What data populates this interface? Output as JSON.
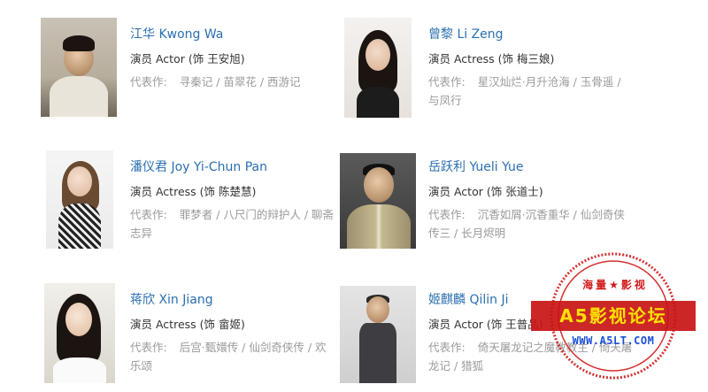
{
  "cast": [
    {
      "name": "江华 Kwong Wa",
      "role": "演员 Actor (饰 王安旭)",
      "works_label": "代表作:",
      "works_line1": "寻秦记 / 苗翠花 / 西游记",
      "works_line2": ""
    },
    {
      "name": "曾黎 Li Zeng",
      "role": "演员 Actress (饰 梅三娘)",
      "works_label": "代表作:",
      "works_line1": "星汉灿烂·月升沧海 / 玉骨遥 /",
      "works_line2": "与凤行"
    },
    {
      "name": "潘仪君 Joy Yi-Chun Pan",
      "role": "演员 Actress (饰 陈楚慧)",
      "works_label": "代表作:",
      "works_line1": "罪梦者 / 八尺门的辩护人 / 聊斋",
      "works_line2": "志异"
    },
    {
      "name": "岳跃利 Yueli Yue",
      "role": "演员 Actor (饰 张道士)",
      "works_label": "代表作:",
      "works_line1": "沉香如屑·沉香重华 / 仙剑奇侠",
      "works_line2": "传三 / 长月烬明"
    },
    {
      "name": "蒋欣 Xin Jiang",
      "role": "演员 Actress (饰 畲姬)",
      "works_label": "代表作:",
      "works_line1": "后宫·甄嬛传 / 仙剑奇侠传 / 欢",
      "works_line2": "乐颂"
    },
    {
      "name": "姬麒麟 Qilin Ji",
      "role": "演员 Actor (饰 王普品)",
      "works_label": "代表作:",
      "works_line1": "倚天屠龙记之魔教教主 / 倚天屠",
      "works_line2": "龙记 / 猎狐"
    }
  ],
  "watermark": {
    "top_text": "海量★影视",
    "title": "A5影视论坛",
    "url": "WWW.A5LT.COM"
  }
}
